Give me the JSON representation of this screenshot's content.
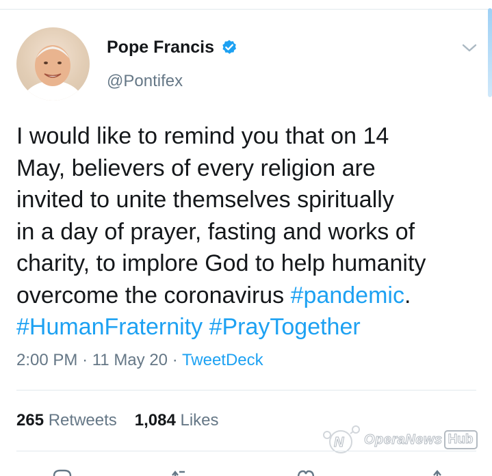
{
  "tweet": {
    "author_name": "Pope Francis",
    "author_handle": "@Pontifex",
    "verified": true,
    "text_lines": [
      "I would like to remind you that on 14",
      "May, believers of every religion are",
      "invited to unite themselves spiritually",
      "in a day of prayer, fasting and works of",
      "charity, to implore God to help humanity",
      "overcome the coronavirus "
    ],
    "inline_hashtag": "#pandemic",
    "inline_hashtag_suffix": ".",
    "hashtag_1": "#HumanFraternity",
    "hashtag_2": "#PrayTogether",
    "time": "2:00 PM",
    "separator": "·",
    "date": "11 May 20",
    "source": "TweetDeck"
  },
  "stats": {
    "retweets_count": "265",
    "retweets_label": "Retweets",
    "likes_count": "1,084",
    "likes_label": "Likes"
  },
  "watermark": {
    "text": "OperaNews",
    "hub": "Hub"
  },
  "icons": {
    "verified": "verified-badge-icon",
    "menu": "chevron-down-icon",
    "reply": "reply-icon",
    "retweet": "retweet-icon",
    "like": "heart-icon",
    "share": "share-icon"
  },
  "colors": {
    "accent": "#1da1f2",
    "text": "#14171a",
    "secondary": "#657786",
    "divider": "#e1e8ed"
  }
}
